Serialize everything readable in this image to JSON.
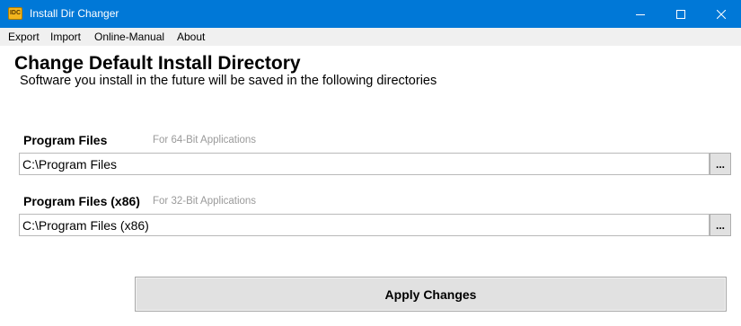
{
  "window": {
    "title": "Install Dir Changer",
    "icon_name": "app-icon",
    "icon_text": "IDC",
    "accent_color": "#0078d7",
    "controls": [
      "minimize-icon",
      "maximize-icon",
      "close-icon"
    ]
  },
  "menu": {
    "items": [
      {
        "label": "Export"
      },
      {
        "label": "Import"
      },
      {
        "label": "Online-Manual"
      },
      {
        "label": "About"
      }
    ]
  },
  "main": {
    "heading": "Change Default Install Directory",
    "subheading": "Software you install in the future will be saved in the following directories",
    "program_files": {
      "label": "Program Files",
      "hint": "For 64-Bit Applications",
      "value": "C:\\Program Files",
      "browse_label": "..."
    },
    "program_files_x86": {
      "label": "Program Files (x86)",
      "hint": "For 32-Bit Applications",
      "value": "C:\\Program Files (x86)",
      "browse_label": "..."
    },
    "apply_label": "Apply Changes"
  }
}
